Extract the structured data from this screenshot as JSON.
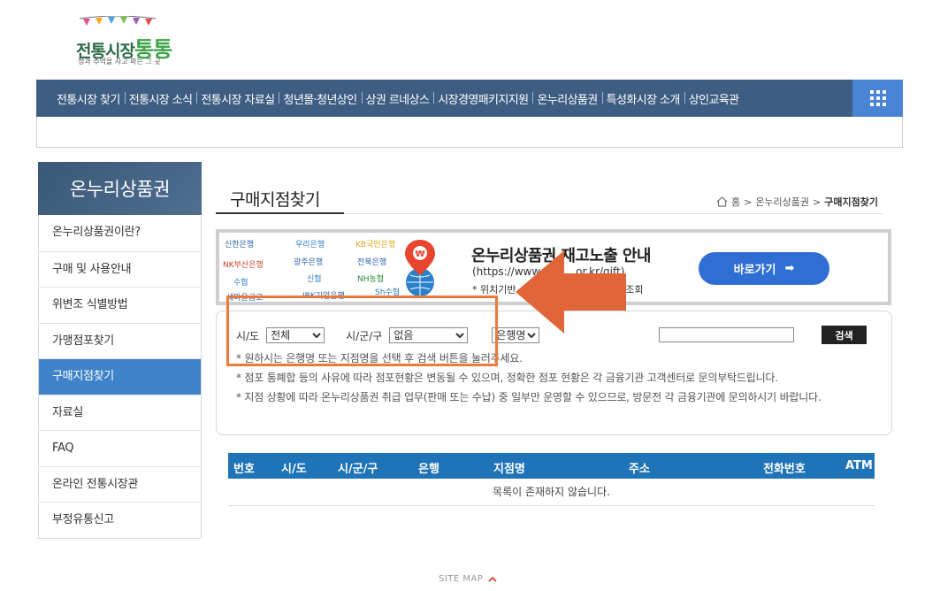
{
  "logo": {
    "title_prefix": "전통시장",
    "title_accent": "통통",
    "slogan": "정과 추억을 사고 파는 그 곳"
  },
  "nav": {
    "items": [
      "전통시장 찾기",
      "전통시장 소식",
      "전통시장 자료실",
      "청년몰·청년상인",
      "상권 르네상스",
      "시장경영패키지지원",
      "온누리상품권",
      "특성화시장 소개",
      "상인교육관"
    ],
    "menu_icon": "grid-icon"
  },
  "sidebar": {
    "title": "온누리상품권",
    "items": [
      "온누리상품권이란?",
      "구매 및 사용안내",
      "위변조 식별방법",
      "가맹점포찾기",
      "구매지점찾기",
      "자료실",
      "FAQ",
      "온라인 전통시장관",
      "부정유통신고"
    ],
    "active_index": 4
  },
  "page": {
    "title": "구매지점찾기",
    "breadcrumb": [
      "홈",
      "온누리상품권",
      "구매지점찾기"
    ]
  },
  "banner": {
    "banks": [
      "신한은행",
      "우리은행",
      "KB국민은행",
      "NK부산은행",
      "광주은행",
      "전북은행",
      "수협",
      "신협",
      "NH농협",
      "IBK기업은행",
      "Sh수협",
      "새마을금고"
    ],
    "title": "온누리상품권 재고노출 안내",
    "url": "(https://www",
    "url_tail": "or.kr/gift)",
    "desc_prefix": "* 위치기반",
    "desc_suffix": "재고 조회",
    "button_label": "바로가기"
  },
  "search": {
    "sido_label": "시/도",
    "sido_value": "전체",
    "sigungu_label": "시/군/구",
    "sigungu_value": "없음",
    "bank_value": "은행명",
    "keyword_value": "",
    "button_label": "검색",
    "notes": [
      "* 원하시는 은행명 또는 지점명을 선택 후 검색 버튼을 눌러주세요.",
      "* 점포 통폐합 등의 사유에 따라 점포현황은 변동될 수 있으며, 정확한 점포 현황은 각 금융기관 고객센터로 문의부탁드립니다.",
      "* 지점 상황에 따라 온누리상품권 취급 업무(판매 또는 수납) 중 일부만 운영할 수 있으므로, 방문전 각 금융기관에 문의하시기 바랍니다."
    ]
  },
  "table": {
    "headers": [
      "번호",
      "시/도",
      "시/군/구",
      "은행",
      "지점명",
      "주소",
      "전화번호",
      "ATM"
    ],
    "empty_message": "목록이 존재하지 않습니다."
  },
  "footer": {
    "sitemap_label": "SITE MAP"
  },
  "colors": {
    "nav_bg": "#3e5d82",
    "nav_grid_btn": "#4a84d5",
    "sidebar_active": "#3f83c9",
    "table_header": "#1f73b7",
    "banner_button": "#2f6fd3",
    "highlight": "#ee7a3a"
  }
}
